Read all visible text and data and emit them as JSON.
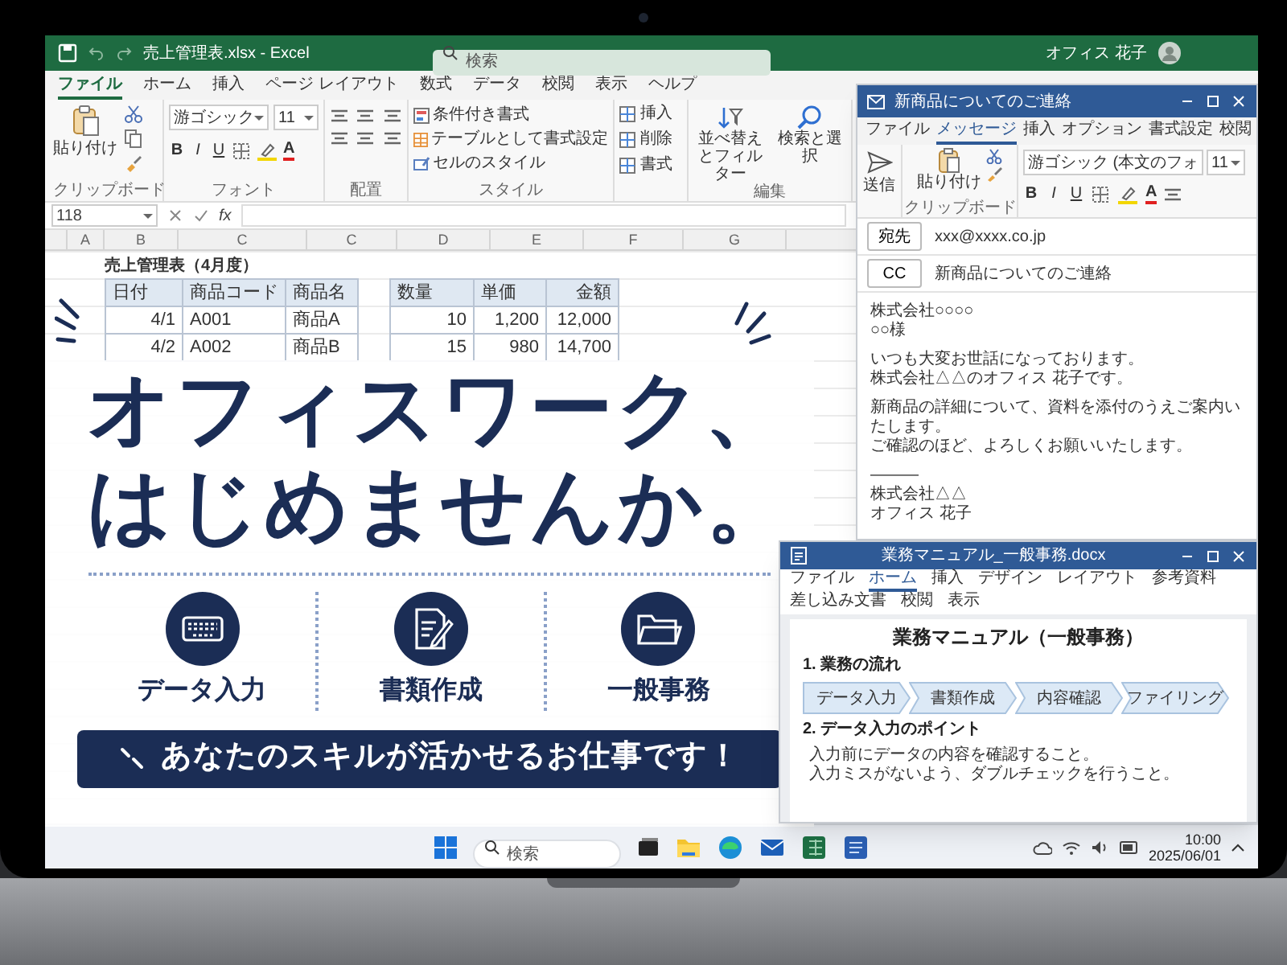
{
  "excel": {
    "title": "売上管理表.xlsx - Excel",
    "search": {
      "placeholder": "検索"
    },
    "user": "オフィス 花子",
    "tabs": [
      {
        "label": "ファイル",
        "selected": true
      },
      {
        "label": "ホーム",
        "selected": false
      },
      {
        "label": "挿入",
        "selected": false
      },
      {
        "label": "ページ レイアウト",
        "selected": false
      },
      {
        "label": "数式",
        "selected": false
      },
      {
        "label": "データ",
        "selected": false
      },
      {
        "label": "校閲",
        "selected": false
      },
      {
        "label": "表示",
        "selected": false
      },
      {
        "label": "ヘルプ",
        "selected": false
      }
    ],
    "ribbon": {
      "paste": "貼り付け",
      "clipboard_group": "クリップボード",
      "font_name": "游ゴシック",
      "font_size": "11",
      "format_buttons": [
        "B",
        "I",
        "U"
      ],
      "font_color": "A",
      "font_group": "フォント",
      "alignment_group": "配置",
      "styles": [
        "条件付き書式",
        "テーブルとして書式設定",
        "セルのスタイル"
      ],
      "styles_group": "スタイル",
      "cells": [
        "挿入",
        "削除",
        "書式"
      ],
      "editing": [
        "並べ替えとフィルター",
        "検索と選択"
      ],
      "editing_group": "編集"
    },
    "name_box": "118",
    "formula_label": "fx",
    "columns": [
      "A",
      "B",
      "C",
      "C",
      "D",
      "E",
      "F",
      "G"
    ],
    "sheet_title": "売上管理表（4月度）",
    "table": {
      "columns": [
        "日付",
        "商品コード",
        "商品名",
        "数量",
        "単価",
        "金額"
      ],
      "rows": [
        [
          "4/1",
          "A001",
          "商品A",
          "10",
          "1,200",
          "12,000"
        ],
        [
          "4/2",
          "A002",
          "商品B",
          "15",
          "980",
          "14,700"
        ]
      ]
    }
  },
  "ad": {
    "headline": [
      "オフィスワーク、",
      "はじめませんか。"
    ],
    "features": [
      {
        "kind": "keyboard",
        "label": "データ入力"
      },
      {
        "kind": "document",
        "label": "書類作成"
      },
      {
        "kind": "folder",
        "label": "一般事務"
      }
    ],
    "banner": "あなたのスキルが活かせるお仕事です！"
  },
  "outlook": {
    "title": "新商品についてのご連絡",
    "tabs": [
      {
        "label": "ファイル",
        "selected": false
      },
      {
        "label": "メッセージ",
        "selected": true
      },
      {
        "label": "挿入",
        "selected": false
      },
      {
        "label": "オプション",
        "selected": false
      },
      {
        "label": "書式設定",
        "selected": false
      },
      {
        "label": "校閲",
        "selected": false
      }
    ],
    "send": "送信",
    "paste": "貼り付け",
    "clipboard_group": "クリップボード",
    "font_name": "游ゴシック (本文のフォ",
    "font_size": "11",
    "format_buttons": [
      "B",
      "I",
      "U"
    ],
    "font_color": "A",
    "to_label": "宛先",
    "to": "xxx@xxxx.co.jp",
    "cc_label": "CC",
    "subject": "新商品についてのご連絡",
    "body": [
      [
        "株式会社○○○○",
        "○○様"
      ],
      [
        "いつも大変お世話になっております。",
        "株式会社△△のオフィス 花子です。"
      ],
      [
        "新商品の詳細について、資料を添付のうえご案内いたします。",
        "ご確認のほど、よろしくお願いいたします。"
      ],
      [
        "———",
        "株式会社△△",
        "オフィス 花子"
      ]
    ]
  },
  "word": {
    "title": "業務マニュアル_一般事務.docx",
    "tabs": [
      {
        "label": "ファイル",
        "selected": false
      },
      {
        "label": "ホーム",
        "selected": true
      },
      {
        "label": "挿入",
        "selected": false
      },
      {
        "label": "デザイン",
        "selected": false
      },
      {
        "label": "レイアウト",
        "selected": false
      },
      {
        "label": "参考資料",
        "selected": false
      },
      {
        "label": "差し込み文書",
        "selected": false
      },
      {
        "label": "校閲",
        "selected": false
      },
      {
        "label": "表示",
        "selected": false
      }
    ],
    "doc_title": "業務マニュアル（一般事務）",
    "sections": [
      {
        "kind": "flow",
        "heading": "1. 業務の流れ",
        "steps": [
          "データ入力",
          "書類作成",
          "内容確認",
          "ファイリング"
        ]
      },
      {
        "kind": "bullets",
        "heading": "2. データ入力のポイント",
        "items": [
          "入力前にデータの内容を確認すること。",
          "入力ミスがないよう、ダブルチェックを行うこと。"
        ]
      }
    ]
  },
  "taskbar": {
    "search": {
      "placeholder": "検索"
    },
    "time": "10:00",
    "date": "2025/06/01"
  }
}
